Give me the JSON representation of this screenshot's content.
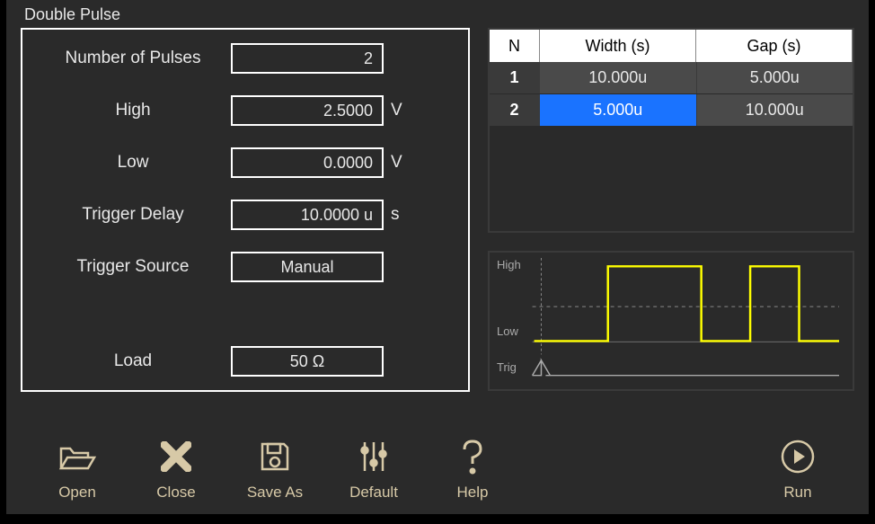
{
  "title": "Double Pulse",
  "form": {
    "num_pulses": {
      "label": "Number of Pulses",
      "value": "2",
      "unit": ""
    },
    "high": {
      "label": "High",
      "value": "2.5000",
      "unit": "V"
    },
    "low": {
      "label": "Low",
      "value": "0.0000",
      "unit": "V"
    },
    "trig_delay": {
      "label": "Trigger Delay",
      "value": "10.0000 u",
      "unit": "s"
    },
    "trig_src": {
      "label": "Trigger Source",
      "value": "Manual",
      "unit": ""
    },
    "load": {
      "label": "Load",
      "value": "50 Ω",
      "unit": ""
    }
  },
  "table": {
    "head": {
      "n": "N",
      "width": "Width (s)",
      "gap": "Gap (s)"
    },
    "rows": [
      {
        "n": "1",
        "width": "10.000u",
        "gap": "5.000u"
      },
      {
        "n": "2",
        "width": "5.000u",
        "gap": "10.000u"
      }
    ],
    "selected": {
      "row": 1,
      "col": "width"
    }
  },
  "wave": {
    "high": "High",
    "low": "Low",
    "trig": "Trig"
  },
  "toolbar": {
    "open": "Open",
    "close": "Close",
    "saveas": "Save As",
    "default": "Default",
    "help": "Help",
    "run": "Run"
  },
  "colors": {
    "wave": "#ffff00",
    "accent": "#d7c9a7",
    "select": "#1a73ff"
  }
}
